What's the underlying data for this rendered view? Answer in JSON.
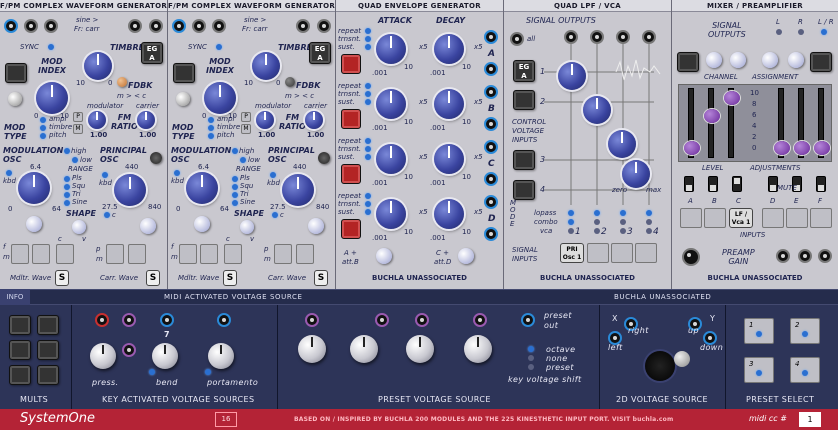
{
  "fm1": {
    "title": "F/PM COMPLEX WAVEFORM GENERATOR",
    "sine_label": "sine >",
    "fr_carr": "Fr: carr",
    "sync": "SYNC",
    "timbre": "TIMBRE",
    "eg": "EG",
    "eg_a": "A",
    "mod_index": "MOD\nINDEX",
    "fdbk": "FDBK",
    "m_lt_c": "m > < c",
    "modulator": "modulator",
    "carrier": "carrier",
    "fm_ratio": "FM\nRATIO",
    "v100a": "1.00",
    "v100b": "1.00",
    "mod": "MOD",
    "type": "TYPE",
    "ampl": "ampl",
    "timbre2": "timbre",
    "pitch": "pitch",
    "mod_osc": "MODULATION\nOSC",
    "high": "high",
    "low": "low",
    "range": "RANGE",
    "pls": "Pls",
    "squ": "Squ",
    "tri": "Tri",
    "sine": "Sine",
    "princ_osc": "PRINCIPAL\nOSC",
    "v64": "6.4",
    "kbd": "kbd",
    "v440": "440",
    "v27": "27.5",
    "v840": "840",
    "v0": "0",
    "v64b": "64",
    "shape": "SHAPE",
    "c": "c",
    "v": "v",
    "f": "f",
    "m": "m",
    "p": "p",
    "m2": "m",
    "mdltr": "Mdltr. Wave",
    "s1": "S",
    "carr": "Carr. Wave",
    "s2": "S",
    "p_btn": "P",
    "m_btn": "M",
    "scale_10": "10",
    "scale_0": "0",
    "scale_10b": "10",
    "scale_0b": "0",
    "scale_0c": "0",
    "scale_10c": "10"
  },
  "fm2": {
    "title": "F/PM COMPLEX WAVEFORM GENERATOR",
    "sine_label": "sine >",
    "fr_carr": "Fr: carr",
    "sync": "SYNC",
    "timbre": "TIMBRE",
    "eg": "EG",
    "eg_a": "A",
    "mod_index": "MOD\nINDEX",
    "fdbk": "FDBK",
    "m_lt_c": "m > < c",
    "modulator": "modulator",
    "carrier": "carrier",
    "fm_ratio": "FM\nRATIO",
    "v100a": "1.00",
    "v100b": "1.00",
    "mod": "MOD",
    "type": "TYPE",
    "ampl": "ampl",
    "timbre2": "timbre",
    "pitch": "pitch",
    "mod_osc": "MODULATION\nOSC",
    "high": "high",
    "low": "low",
    "range": "RANGE",
    "pls": "Pls",
    "squ": "Squ",
    "tri": "Tri",
    "sine": "Sine",
    "princ_osc": "PRINCIPAL\nOSC",
    "v64": "6.4",
    "kbd": "kbd",
    "v440": "440",
    "v27": "27.5",
    "v840": "840",
    "v0": "0",
    "v64b": "64",
    "shape": "SHAPE",
    "c": "c",
    "v": "v",
    "f": "f",
    "m": "m",
    "p": "p",
    "m2": "m",
    "mdltr": "Mdltr. Wave",
    "s1": "S",
    "carr": "Carr. Wave",
    "s2": "S",
    "p_btn": "P",
    "m_btn": "M",
    "scale_10": "10",
    "scale_0": "0",
    "scale_10b": "10",
    "scale_0b": "0",
    "scale_0c": "0",
    "scale_10c": "10"
  },
  "env": {
    "title": "QUAD  ENVELOPE  GENERATOR",
    "attack": "ATTACK",
    "decay": "DECAY",
    "repeat": "repeat",
    "trnsnt": "trnsnt.",
    "sust": "sust.",
    "x5": "x5",
    "v10": "10",
    "v001": ".001",
    "rows": [
      "A",
      "B",
      "C",
      "D"
    ],
    "a_plus": "A +",
    "att_b": "att.B",
    "c_plus": "C +",
    "att_d": "att.D",
    "footer": "BUCHLA  UNASSOCIATED"
  },
  "lpf": {
    "title": "QUAD LPF / VCA",
    "sig_out": "SIGNAL OUTPUTS",
    "all": "all",
    "eg": "EG",
    "eg_a": "A",
    "cv_inputs": "CONTROL\nVOLTAGE\nINPUTS",
    "rows": [
      "1",
      "2",
      "3",
      "4"
    ],
    "zero": "zero",
    "max": "max",
    "mode": "M\nO\nD\nE",
    "lopass": "lopass",
    "combo": "combo",
    "vca": "vca",
    "cols": [
      "1",
      "2",
      "3",
      "4"
    ],
    "sig_inputs": "SIGNAL\nINPUTS",
    "pri": "PRI",
    "osc1": "Osc 1",
    "footer": "BUCHLA  UNASSOCIATED"
  },
  "mixer": {
    "title": "MIXER / PREAMPLIFIER",
    "sig_out": "SIGNAL\nOUTPUTS",
    "l": "L",
    "r": "R",
    "lr": "L / R",
    "channel": "CHANNEL",
    "assignment": "ASSIGNMENT",
    "scale": [
      "10",
      "8",
      "6",
      "4",
      "2",
      "0"
    ],
    "level": "LEVEL",
    "adjustments": "ADJUSTMENTS",
    "mute": "MUTE",
    "inputs_letters": [
      "A",
      "B",
      "C",
      "D",
      "E",
      "F"
    ],
    "lf_vca": "LF /\nVca 1",
    "inputs": "INPUTS",
    "preamp": "PREAMP\nGAIN",
    "footer": "BUCHLA  UNASSOCIATED"
  },
  "strip": {
    "info": "INFO",
    "midi": "MIDI   ACTIVATED   VOLTAGE   SOURCE",
    "buchla": "BUCHLA     UNASSOCIATED"
  },
  "bottom": {
    "mults": "MULTS",
    "kavs": "KEY  ACTIVATED  VOLTAGE  SOURCES",
    "press": "press.",
    "bend": "bend",
    "portamento": "portamento",
    "seven": "7",
    "pvs": "PRESET  VOLTAGE  SOURCE",
    "preset_out": "preset\nout",
    "octave": "octave",
    "none": "none",
    "preset": "preset",
    "key_shift": "key  voltage  shift",
    "vs2d": "2D  VOLTAGE  SOURCE",
    "x": "X",
    "y": "Y",
    "right": "right",
    "left": "left",
    "up": "up",
    "down": "down",
    "preset_select": "PRESET  SELECT",
    "presets": [
      "1",
      "2",
      "3",
      "4"
    ]
  },
  "footer": {
    "app": "SystemOne",
    "num": "16",
    "credit": "BASED ON / INSPIRED BY BUCHLA 200 MODULES AND THE 225 KINESTHETIC INPUT PORT.  VISIT buchla.com",
    "midi_cc": "midi cc #",
    "cc_val": "1"
  }
}
